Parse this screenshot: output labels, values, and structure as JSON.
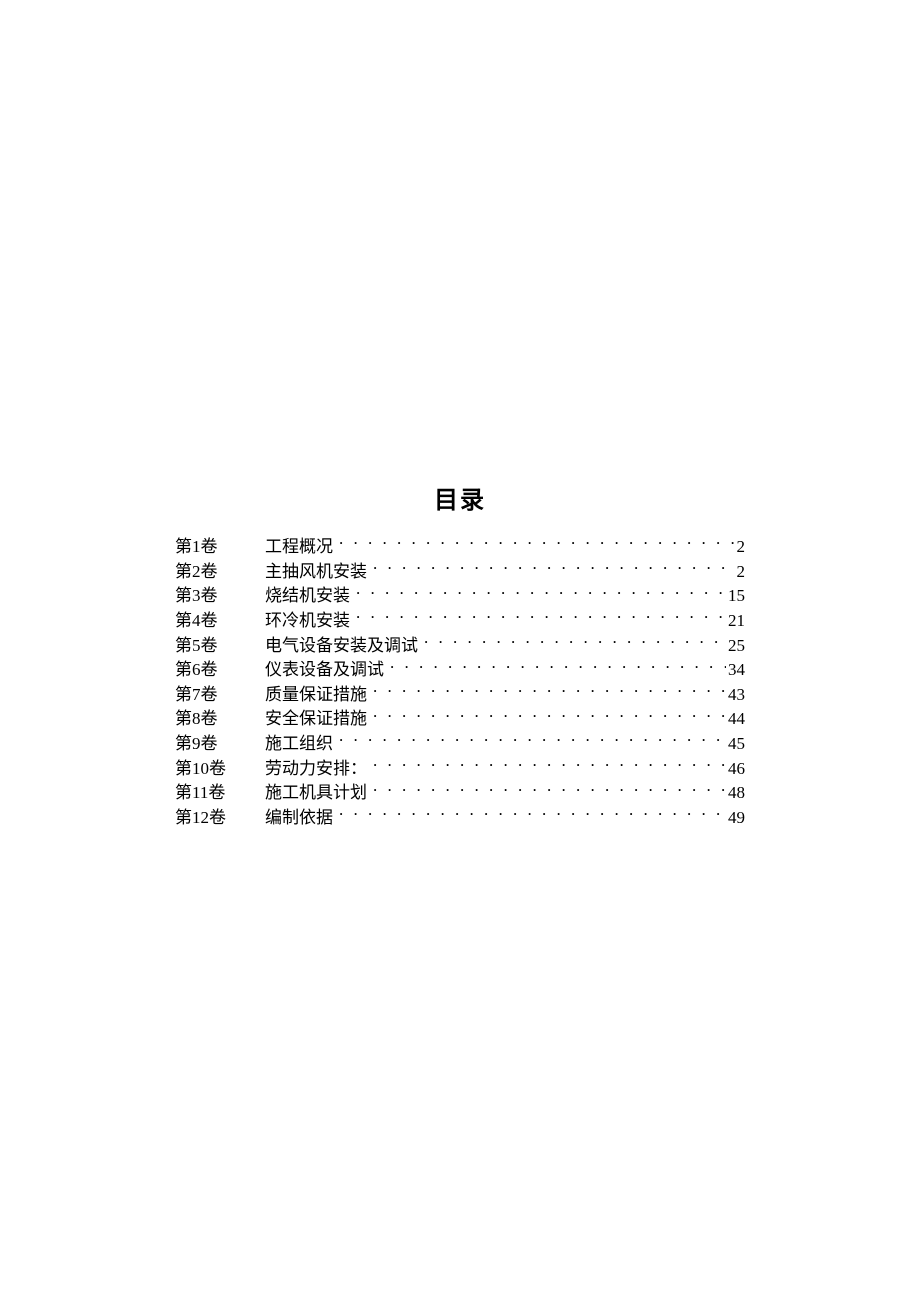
{
  "toc": {
    "title": "目录",
    "entries": [
      {
        "volume": "第1卷",
        "title": "工程概况",
        "page": "2"
      },
      {
        "volume": "第2卷",
        "title": "主抽风机安装",
        "page": "2"
      },
      {
        "volume": "第3卷",
        "title": "烧结机安装",
        "page": "15"
      },
      {
        "volume": "第4卷",
        "title": "环冷机安装",
        "page": "21"
      },
      {
        "volume": "第5卷",
        "title": "电气设备安装及调试",
        "page": "25"
      },
      {
        "volume": "第6卷",
        "title": "仪表设备及调试",
        "page": "34"
      },
      {
        "volume": "第7卷",
        "title": "质量保证措施",
        "page": "43"
      },
      {
        "volume": "第8卷",
        "title": "安全保证措施",
        "page": "44"
      },
      {
        "volume": "第9卷",
        "title": "施工组织",
        "page": "45"
      },
      {
        "volume": "第10卷",
        "title": "劳动力安排：",
        "page": "46"
      },
      {
        "volume": "第11卷",
        "title": "施工机具计划",
        "page": "48"
      },
      {
        "volume": "第12卷",
        "title": "编制依据",
        "page": "49"
      }
    ]
  }
}
